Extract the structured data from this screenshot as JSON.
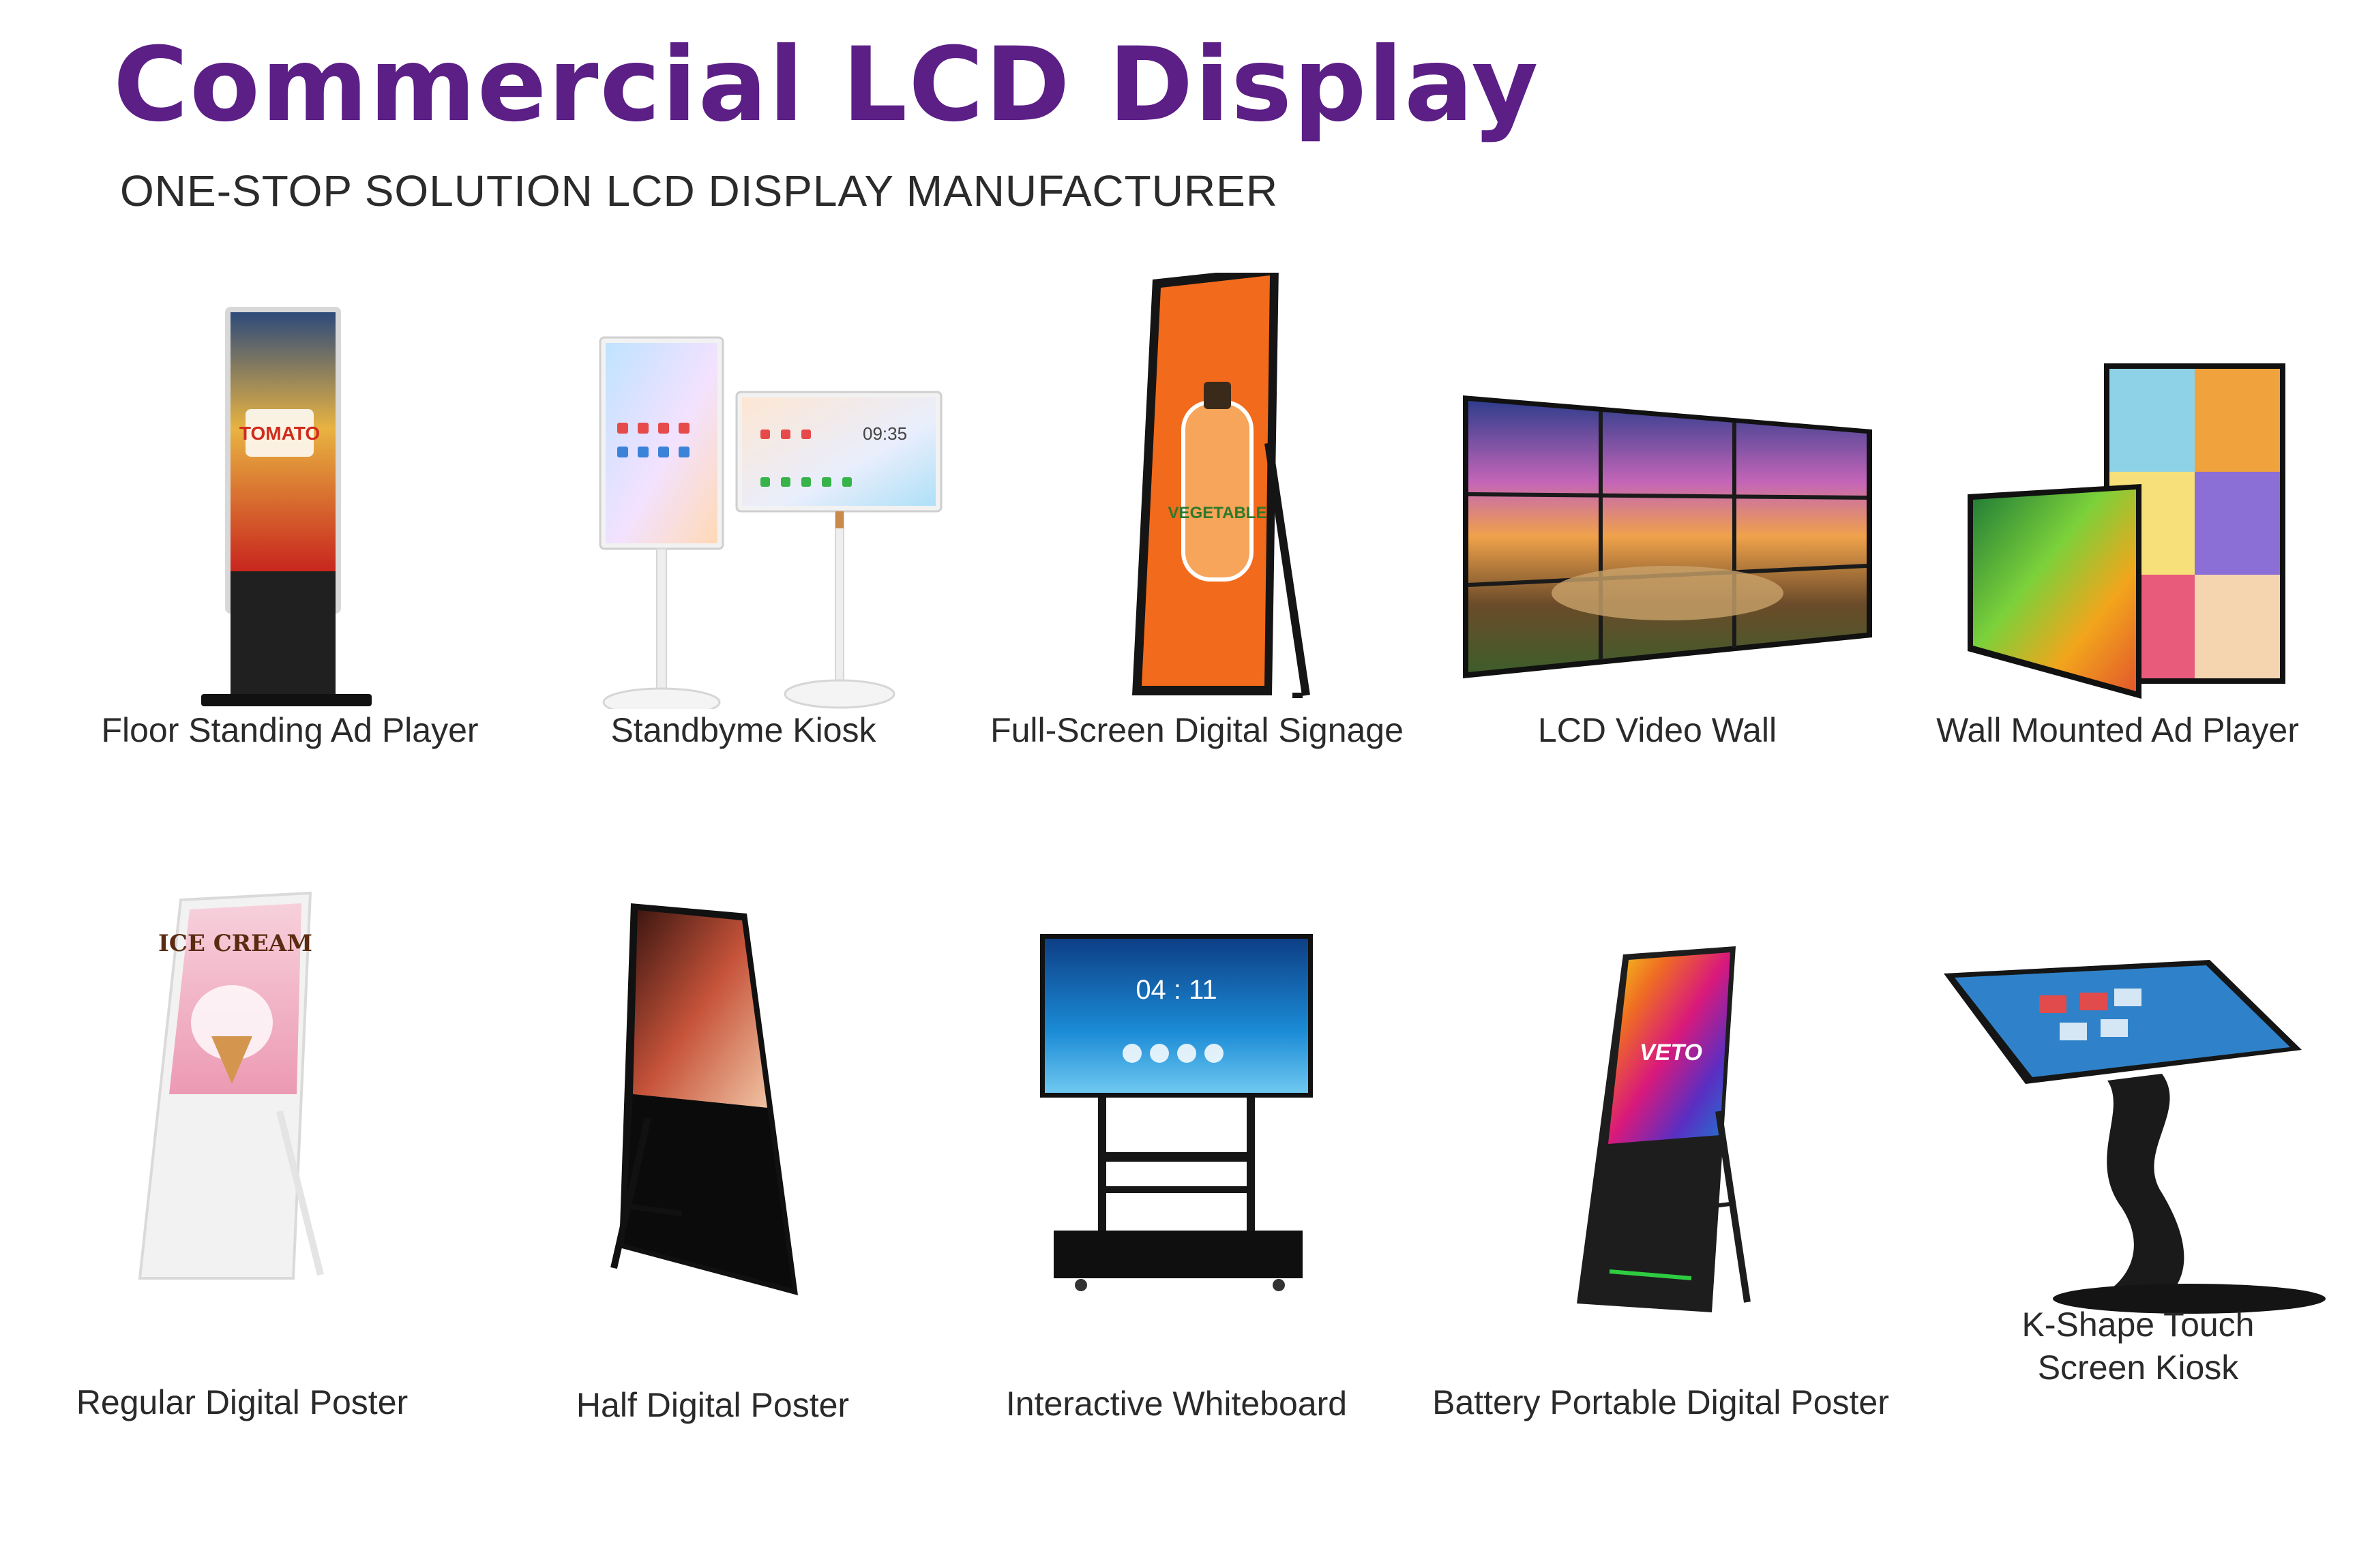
{
  "header": {
    "title": "Commercial LCD Display",
    "subtitle": "ONE-STOP SOLUTION LCD DISPLAY MANUFACTURER"
  },
  "colors": {
    "title": "#5b1f86",
    "frame": "#1a1a1a",
    "accent_orange": "#f26a1b"
  },
  "products": [
    {
      "label": "Floor Standing Ad Player",
      "icon": "floor-standing-ad-player-image"
    },
    {
      "label": "Standbyme Kiosk",
      "icon": "standbyme-kiosk-image",
      "screen_time": "09:35"
    },
    {
      "label": "Full-Screen Digital Signage",
      "icon": "full-screen-digital-signage-image"
    },
    {
      "label": "LCD Video Wall",
      "icon": "lcd-video-wall-image"
    },
    {
      "label": "Wall Mounted Ad Player",
      "icon": "wall-mounted-ad-player-image"
    },
    {
      "label": "Regular Digital Poster",
      "icon": "regular-digital-poster-image"
    },
    {
      "label": "Half Digital Poster",
      "icon": "half-digital-poster-image"
    },
    {
      "label": "Interactive Whiteboard",
      "icon": "interactive-whiteboard-image",
      "screen_time": "04 : 11"
    },
    {
      "label": "Battery Portable Digital Poster",
      "icon": "battery-portable-digital-poster-image",
      "screen_brand": "VETO"
    },
    {
      "label_line1": "K-Shape Touch",
      "label_line2": "Screen Kiosk",
      "icon": "k-shape-touch-screen-kiosk-image"
    }
  ]
}
